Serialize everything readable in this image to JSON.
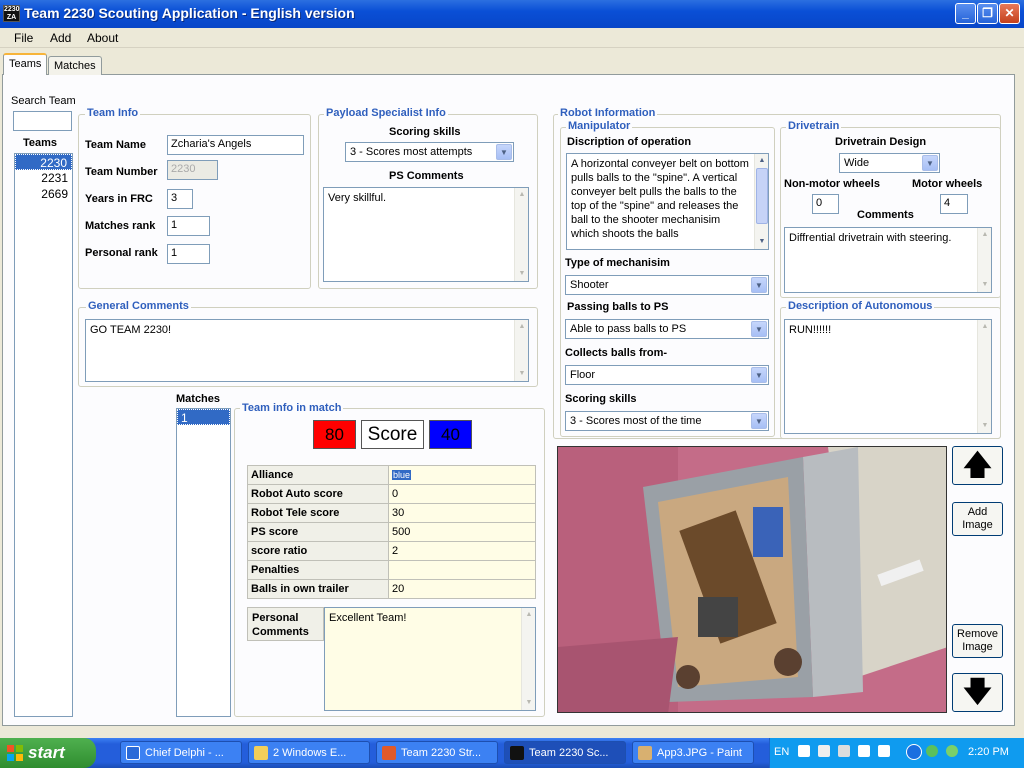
{
  "window": {
    "title": "Team 2230 Scouting Application - English version",
    "app_icon_text": "2230 ZA"
  },
  "menu": [
    "File",
    "Add",
    "About"
  ],
  "tabs": [
    {
      "label": "Teams",
      "active": true
    },
    {
      "label": "Matches",
      "active": false
    }
  ],
  "search": {
    "label": "Search Team",
    "value": ""
  },
  "teams_list": {
    "header": "Teams",
    "items": [
      "2230",
      "2231",
      "2669"
    ],
    "selected": "2230"
  },
  "team_info": {
    "title": "Team Info",
    "name_label": "Team Name",
    "name": "Zcharia's Angels",
    "number_label": "Team Number",
    "number": "2230",
    "years_label": "Years in FRC",
    "years": "3",
    "matches_rank_label": "Matches rank",
    "matches_rank": "1",
    "personal_rank_label": "Personal rank",
    "personal_rank": "1"
  },
  "payload": {
    "title": "Payload Specialist Info",
    "scoring_label": "Scoring skills",
    "scoring": "3 - Scores most attempts",
    "comments_label": "PS Comments",
    "comments": "Very skillful."
  },
  "general": {
    "title": "General Comments",
    "text": "GO TEAM 2230!"
  },
  "robot": {
    "title": "Robot Information",
    "manipulator": {
      "title": "Manipulator",
      "desc_label": "Discription of operation",
      "desc": "A horizontal conveyer belt on bottom pulls balls to the \"spine\". A vertical conveyer belt pulls the balls to the top of the \"spine\" and releases the ball to the shooter mechanisim which shoots the balls",
      "mech_label": "Type of mechanisim",
      "mech": "Shooter",
      "passing_label": "Passing balls to PS",
      "passing": "Able to pass balls to PS",
      "collects_label": "Collects balls from-",
      "collects": "Floor",
      "scoring_label": "Scoring skills",
      "scoring": "3 - Scores most of the time"
    },
    "drivetrain": {
      "title": "Drivetrain",
      "design_label": "Drivetrain Design",
      "design": "Wide",
      "nonmotor_label": "Non-motor wheels",
      "nonmotor": "0",
      "motor_label": "Motor wheels",
      "motor": "4",
      "comments_label": "Comments",
      "comments": "Diffrential drivetrain with steering."
    },
    "autonomous": {
      "title": "Description of Autonomous",
      "text": "RUN!!!!!!"
    }
  },
  "matches": {
    "label": "Matches",
    "items": [
      "1"
    ],
    "selected": "1"
  },
  "match_info": {
    "title": "Team info in match",
    "red_score": "80",
    "score_label": "Score",
    "blue_score": "40",
    "rows": [
      {
        "key": "Alliance",
        "value": "blue"
      },
      {
        "key": "Robot Auto score",
        "value": "0"
      },
      {
        "key": "Robot Tele score",
        "value": "30"
      },
      {
        "key": "PS score",
        "value": "500"
      },
      {
        "key": "score ratio",
        "value": "2"
      },
      {
        "key": "Penalties",
        "value": ""
      },
      {
        "key": "Balls in own trailer",
        "value": "20"
      }
    ],
    "personal_label": "Personal Comments",
    "personal": "Excellent Team!"
  },
  "image_buttons": {
    "add": "Add Image",
    "remove": "Remove Image"
  },
  "taskbar": {
    "start": "start",
    "tasks": [
      "Chief Delphi - ...",
      "2 Windows E...",
      "Team 2230 Str...",
      "Team 2230 Sc...",
      "App3.JPG - Paint"
    ],
    "lang": "EN",
    "clock": "2:20 PM"
  },
  "colors": {
    "red_alliance": "#ff0000",
    "blue_alliance": "#0000ff",
    "group_title": "#2f5fbd",
    "selection": "#316ac5"
  }
}
